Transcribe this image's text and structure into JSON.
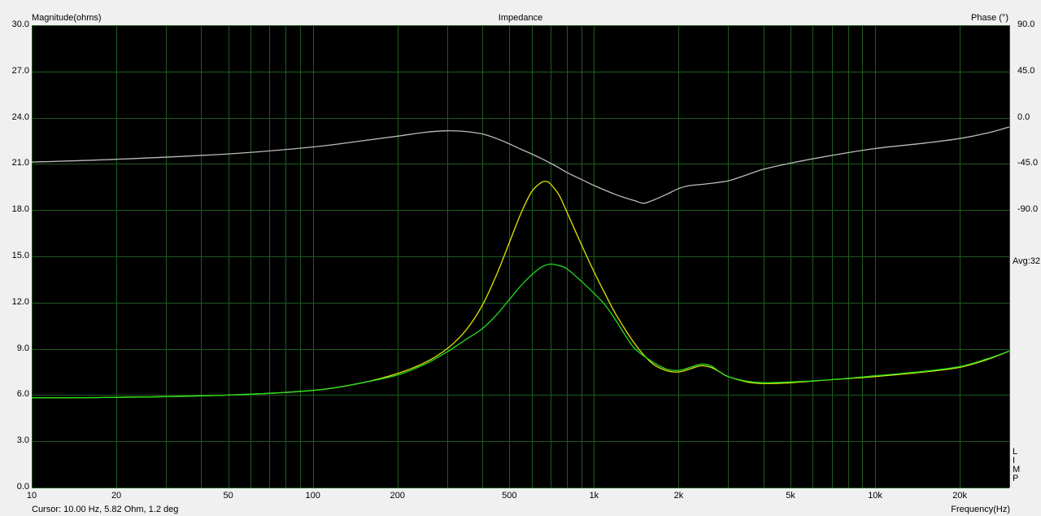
{
  "chart_data": {
    "type": "line",
    "title": "Impedance",
    "ylabel": "Magnitude(ohms)",
    "y2label": "Phase (°)",
    "xlabel": "Frequency(Hz)",
    "x_scale": "log",
    "xlim": [
      10,
      30000
    ],
    "ylim": [
      0,
      30
    ],
    "y2lim": [
      -210,
      90
    ],
    "y_ticks": [
      "30.0",
      "27.0",
      "24.0",
      "21.0",
      "18.0",
      "15.0",
      "12.0",
      "9.0",
      "6.0",
      "3.0",
      "0.0"
    ],
    "y2_ticks": [
      "90.0",
      "45.0",
      "0.0",
      "-45.0",
      "-90.0"
    ],
    "x_ticks": [
      {
        "value": 10,
        "label": "10"
      },
      {
        "value": 20,
        "label": "20"
      },
      {
        "value": 50,
        "label": "50"
      },
      {
        "value": 100,
        "label": "100"
      },
      {
        "value": 200,
        "label": "200"
      },
      {
        "value": 500,
        "label": "500"
      },
      {
        "value": 1000,
        "label": "1k"
      },
      {
        "value": 2000,
        "label": "2k"
      },
      {
        "value": 5000,
        "label": "5k"
      },
      {
        "value": 10000,
        "label": "10k"
      },
      {
        "value": 20000,
        "label": "20k"
      }
    ],
    "grid": true,
    "colors": {
      "background": "#000000",
      "grid": "#1f5a1f",
      "frame_bg": "#f0f0f0"
    },
    "series": [
      {
        "axis": "left",
        "color": "#e6e600",
        "x": [
          10,
          20,
          50,
          100,
          150,
          200,
          250,
          300,
          350,
          400,
          450,
          500,
          550,
          600,
          650,
          680,
          700,
          750,
          800,
          900,
          1000,
          1100,
          1200,
          1400,
          1600,
          1800,
          2000,
          2200,
          2400,
          2600,
          2800,
          3000,
          3500,
          4000,
          5000,
          7000,
          10000,
          15000,
          20000,
          25000,
          30000
        ],
        "y": [
          5.82,
          5.85,
          6.0,
          6.3,
          6.8,
          7.4,
          8.1,
          9.0,
          10.2,
          11.8,
          13.8,
          15.9,
          17.8,
          19.2,
          19.8,
          19.85,
          19.7,
          19.0,
          17.9,
          15.8,
          14.0,
          12.5,
          11.2,
          9.3,
          8.1,
          7.6,
          7.5,
          7.7,
          7.9,
          7.8,
          7.5,
          7.2,
          6.85,
          6.75,
          6.8,
          7.0,
          7.2,
          7.5,
          7.8,
          8.3,
          8.85
        ]
      },
      {
        "axis": "left",
        "color": "#22dd22",
        "x": [
          10,
          20,
          50,
          100,
          150,
          200,
          250,
          300,
          350,
          400,
          450,
          500,
          550,
          600,
          650,
          700,
          750,
          800,
          900,
          1000,
          1100,
          1200,
          1300,
          1400,
          1600,
          1800,
          2000,
          2200,
          2400,
          2600,
          2800,
          3000,
          3500,
          4000,
          5000,
          7000,
          10000,
          15000,
          20000,
          25000,
          30000
        ],
        "y": [
          5.82,
          5.85,
          6.0,
          6.3,
          6.8,
          7.3,
          8.0,
          8.8,
          9.6,
          10.3,
          11.2,
          12.2,
          13.1,
          13.8,
          14.3,
          14.5,
          14.4,
          14.2,
          13.4,
          12.6,
          11.8,
          10.8,
          9.8,
          9.0,
          8.2,
          7.7,
          7.6,
          7.8,
          8.0,
          7.9,
          7.5,
          7.2,
          6.9,
          6.8,
          6.85,
          7.0,
          7.25,
          7.55,
          7.85,
          8.35,
          8.85
        ]
      },
      {
        "axis": "right",
        "color": "#bbbbbb",
        "x": [
          10,
          20,
          50,
          100,
          150,
          200,
          250,
          300,
          350,
          400,
          450,
          500,
          550,
          600,
          650,
          700,
          750,
          800,
          900,
          1000,
          1200,
          1400,
          1500,
          1600,
          1800,
          2000,
          2200,
          2500,
          3000,
          3500,
          4000,
          5000,
          7000,
          10000,
          15000,
          20000,
          25000,
          30000
        ],
        "y": [
          1.2,
          3.0,
          6.5,
          11.0,
          15.0,
          18.0,
          20.5,
          21.5,
          21.0,
          19.5,
          16.5,
          13.0,
          9.5,
          6.5,
          3.5,
          0.5,
          -2.5,
          -5.5,
          -10.0,
          -14.0,
          -20.0,
          -24.0,
          -25.5,
          -24.0,
          -20.0,
          -16.0,
          -14.0,
          -13.0,
          -11.0,
          -7.0,
          -3.5,
          0.5,
          5.5,
          10.0,
          13.5,
          16.5,
          20.0,
          24.0
        ]
      }
    ],
    "annotations": [
      "Avg:32"
    ]
  },
  "status": {
    "cursor": "Cursor: 10.00 Hz, 5.82 Ohm, 1.2 deg"
  },
  "side_letters": [
    "L",
    "I",
    "M",
    "P"
  ]
}
